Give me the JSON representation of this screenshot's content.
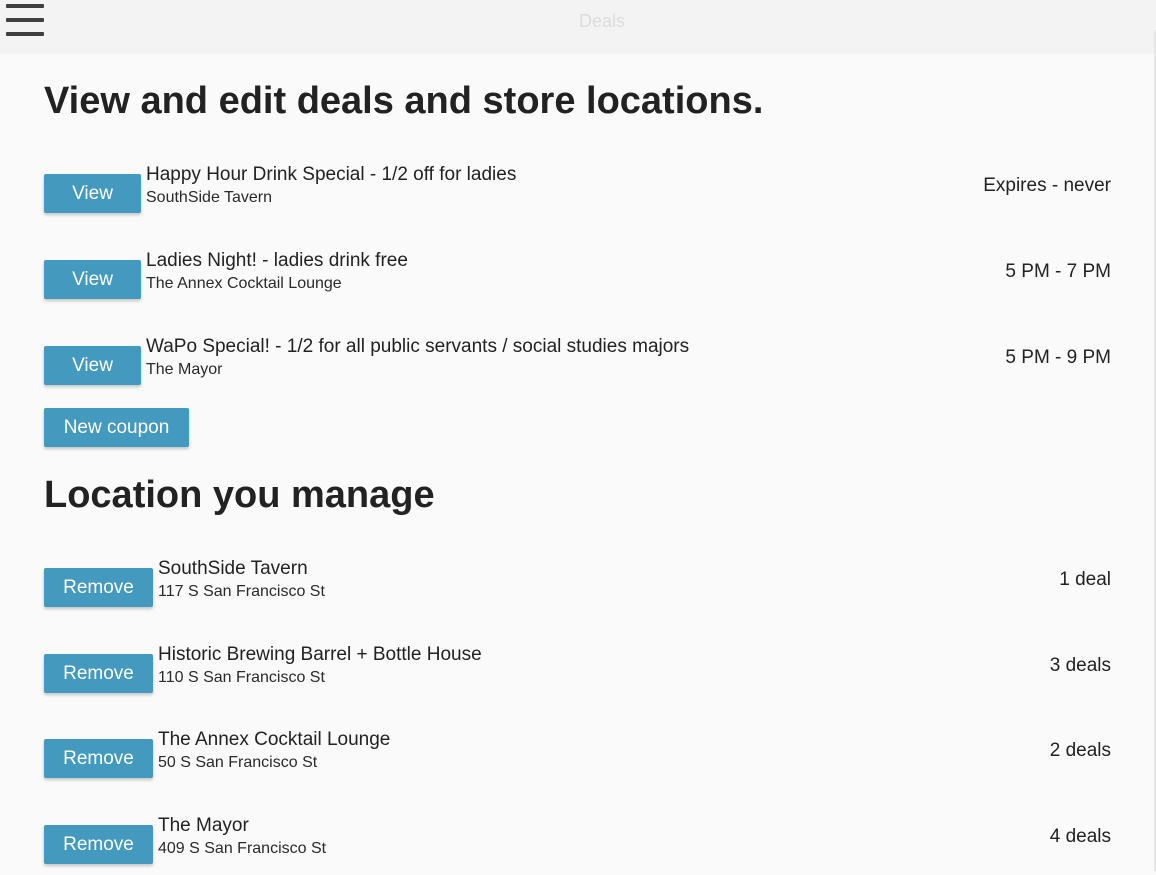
{
  "topbar": {
    "title": "Deals"
  },
  "deals_section": {
    "heading": "View and edit deals and store locations.",
    "view_label": "View",
    "deals": [
      {
        "title": "Happy Hour Drink Special - 1/2 off for ladies",
        "location": "SouthSide Tavern",
        "time": "Expires - never"
      },
      {
        "title": "Ladies Night! - ladies drink free",
        "location": "The Annex Cocktail Lounge",
        "time": "5 PM - 7 PM"
      },
      {
        "title": "WaPo Special! - 1/2 for all public servants / social studies majors",
        "location": "The Mayor",
        "time": "5 PM - 9 PM"
      }
    ],
    "new_coupon_label": "New coupon"
  },
  "locations_section": {
    "heading": "Location you manage",
    "remove_label": "Remove",
    "locations": [
      {
        "name": "SouthSide Tavern",
        "address": "117 S San Francisco St",
        "deal_count": "1 deal"
      },
      {
        "name": "Historic Brewing Barrel + Bottle House",
        "address": "110 S San Francisco St",
        "deal_count": "3 deals"
      },
      {
        "name": "The Annex Cocktail Lounge",
        "address": "50 S San Francisco St",
        "deal_count": "2 deals"
      },
      {
        "name": "The Mayor",
        "address": "409 S San Francisco St",
        "deal_count": "4 deals"
      }
    ]
  },
  "colors": {
    "button": "#4399be",
    "topbar": "#f3f3f3",
    "background": "#fafafa"
  },
  "icons": {
    "menu": "hamburger-menu-icon"
  }
}
